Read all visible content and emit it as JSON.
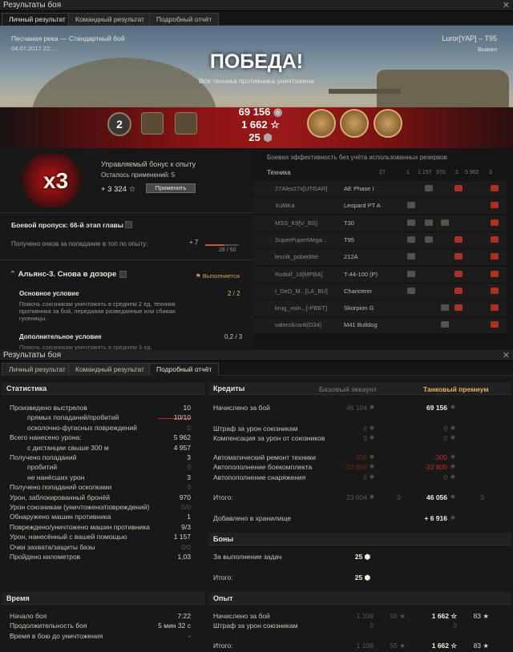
{
  "window1": {
    "title": "Результаты боя",
    "close": "✕",
    "tabs": [
      "Личный результат",
      "Командный результат",
      "Подробный отчёт"
    ]
  },
  "hero": {
    "map": "Песчаная река — Стандартный бой",
    "date": "04.07.2017 22:...",
    "player": "Luror[YAP] – T95",
    "status": "Выжил",
    "title": "ПОБЕДА!",
    "subtitle": "Вся техника противника уничтожена",
    "rank": "2",
    "credits": "69 156",
    "xp": "1 662",
    "bonds": "25"
  },
  "bonus": {
    "title": "Управляемый бонус к опыту",
    "remaining": "Осталось применений: 5",
    "xp": "+ 3 324",
    "apply": "Применить",
    "mult": "x3"
  },
  "battlepass": {
    "title": "Боевой пропуск: 66-й этап главы II.",
    "desc": "Получено очков за попадание в топ по опыту:",
    "points": "+ 7",
    "progress": "28 / 50",
    "progress_fraction": 0.56
  },
  "mission": {
    "title": "Альянс-3. Снова в дозоре",
    "state": "Выполняется",
    "main_title": "Основное условие",
    "main_desc": "Помочь союзникам уничтожить в среднем 2 ед. техники противника за бой, передавая разведанные или сбивая гусеницы.",
    "main_val": "2 / 2",
    "add_title": "Дополнительное условие",
    "add_desc": "Помочь союзникам уничтожить в среднем 3 ед.",
    "add_val": "0,2 / 3"
  },
  "team": {
    "header": "Боевая эффективность без учёта использованных резервов",
    "col_vehicle": "Техника",
    "cols": [
      "27",
      "1",
      "1 157",
      "970",
      "2",
      "5 962",
      "3"
    ],
    "rows": [
      {
        "name": "27Alex27x[UTGAR]",
        "tank": "AE Phase I"
      },
      {
        "name": "XuMKa",
        "tank": "Leopard PT A"
      },
      {
        "name": "MSS_K9[V_BS]",
        "tank": "T30"
      },
      {
        "name": "SuperPuperMega...",
        "tank": "T95"
      },
      {
        "name": "lesnik_pobeditel",
        "tank": "212A"
      },
      {
        "name": "Rudolf_18[MPBA]",
        "tank": "T-44-100 (P)"
      },
      {
        "name": "I_DeD_M...[LA_BU]",
        "tank": "Charioteer"
      },
      {
        "name": "krug_voin...[-PBET]",
        "tank": "Skorpion G"
      },
      {
        "name": "valercikrank[D34]",
        "tank": "M41 Bulldog"
      }
    ]
  },
  "window2": {
    "title": "Результаты боя",
    "close": "✕",
    "tabs": [
      "Личный результат",
      "Командный результат",
      "Подробный отчёт"
    ]
  },
  "stats": {
    "header": "Статистика",
    "rows": [
      {
        "label": "Произведено выстрелов",
        "value": "10"
      },
      {
        "label": "прямых попаданий/пробитий",
        "value": "10/10"
      },
      {
        "label": "осколочно-фугасных повреждений",
        "value": "0"
      },
      {
        "label": "Всего нанесено урона:",
        "value": "5 962"
      },
      {
        "label": "с дистанции свыше 300 м",
        "value": "4 957"
      },
      {
        "label": "Получено попаданий",
        "value": "3"
      },
      {
        "label": "пробитий",
        "value": "0"
      },
      {
        "label": "не нанёсших урон",
        "value": "3"
      },
      {
        "label": "Получено попаданий осколками",
        "value": "0"
      },
      {
        "label": "Урон, заблокированный бронёй",
        "value": "970"
      },
      {
        "label": "Урон союзникам (уничтожено/повреждений)",
        "value": "0/0"
      },
      {
        "label": "Обнаружено машин противника",
        "value": "1"
      },
      {
        "label": "Повреждено/уничтожено машин противника",
        "value": "9/3"
      },
      {
        "label": "Урон, нанесённый с вашей помощью",
        "value": "1 157"
      },
      {
        "label": "Очки захвата/защиты базы",
        "value": "0/0"
      },
      {
        "label": "Пройдено километров",
        "value": "1,03"
      }
    ]
  },
  "time": {
    "header": "Время",
    "rows": [
      {
        "label": "Начало боя",
        "value": "7:22"
      },
      {
        "label": "Продолжительность боя",
        "value": "5 мин 32 с"
      },
      {
        "label": "Время в бою до уничтожения",
        "value": "-"
      }
    ]
  },
  "credits": {
    "header": "Кредиты",
    "base": "Базовый аккаунт",
    "premium": "Танковый премиум",
    "rows": [
      {
        "label": "Начислено за бой",
        "base": "46 104",
        "prem": "69 156"
      },
      {
        "label": "Штраф за урон союзникам",
        "base": "0",
        "prem": "0"
      },
      {
        "label": "Компенсация за урон от союзников",
        "base": "0",
        "prem": "0"
      },
      {
        "label": "Автоматический ремонт техники",
        "base": "-300",
        "prem": "-300"
      },
      {
        "label": "Автопополнение боекомплекта",
        "base": "-22 800",
        "prem": "-22 800"
      },
      {
        "label": "Автопополнение снаряжения",
        "base": "0",
        "prem": "0"
      },
      {
        "label": "Итого:",
        "base": "23 004",
        "bonds_b": "0",
        "prem": "46 056",
        "bonds_p": "0"
      },
      {
        "label": "Добавлено в хранилище",
        "base": "",
        "prem": "+ 6 916"
      }
    ]
  },
  "bonds": {
    "header": "Боны",
    "rows": [
      {
        "label": "За выполнение задач",
        "value": "25"
      },
      {
        "label": "Итого:",
        "value": "25"
      }
    ]
  },
  "exp": {
    "header": "Опыт",
    "rows": [
      {
        "label": "Начислено за бой",
        "base": "1 108",
        "base2": "55",
        "prem": "1 662",
        "prem2": "83"
      },
      {
        "label": "Штраф за урон союзникам",
        "base": "0",
        "base2": "",
        "prem": "0",
        "prem2": ""
      },
      {
        "label": "Итого:",
        "base": "1 108",
        "base2": "55",
        "prem": "1 662",
        "prem2": "83"
      }
    ]
  },
  "colors": {
    "accent": "#e8b060",
    "red": "#c83020",
    "bg": "#171817"
  }
}
